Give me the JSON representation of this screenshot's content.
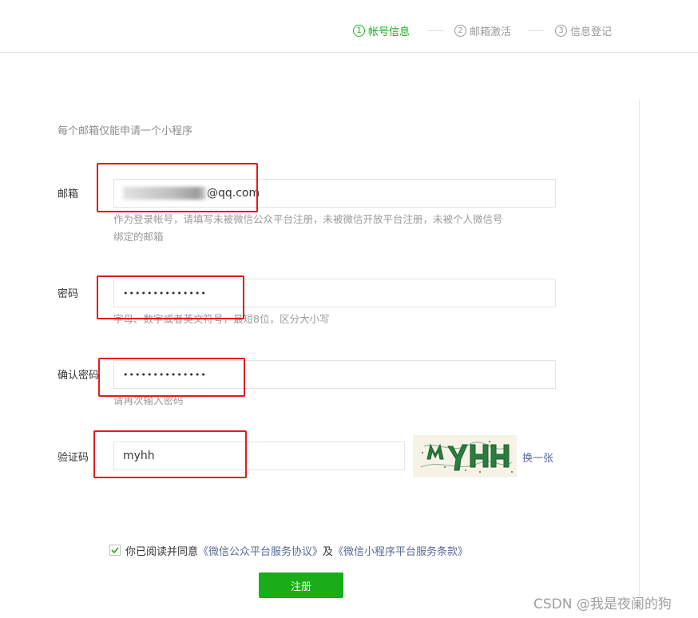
{
  "steps": [
    {
      "num": "1",
      "label": "帐号信息"
    },
    {
      "num": "2",
      "label": "邮箱激活"
    },
    {
      "num": "3",
      "label": "信息登记"
    }
  ],
  "form": {
    "tip": "每个邮箱仅能申请一个小程序",
    "email": {
      "label": "邮箱",
      "value_suffix": "@qq.com",
      "hint_line1": "作为登录帐号，请填写未被微信公众平台注册，未被微信开放平台注册，未被个人微信号",
      "hint_line2": "绑定的邮箱"
    },
    "password": {
      "label": "密码",
      "value": "••••••••••••••",
      "hint": "字母、数字或者英文符号，最短8位，区分大小写"
    },
    "confirm": {
      "label": "确认密码",
      "value": "••••••••••••••",
      "hint": "请再次输入密码"
    },
    "captcha": {
      "label": "验证码",
      "value": "myhh",
      "image_text": "MYHH",
      "refresh": "换一张"
    },
    "agreement": {
      "checked": true,
      "prefix": "你已阅读并同意",
      "link1": "《微信公众平台服务协议》",
      "middle": "及",
      "link2": "《微信小程序平台服务条款》"
    },
    "submit": "注册"
  },
  "colors": {
    "accent": "#1aad19",
    "link": "#576b95",
    "highlight": "#e31b1b"
  },
  "watermark": "CSDN @我是夜阑的狗"
}
